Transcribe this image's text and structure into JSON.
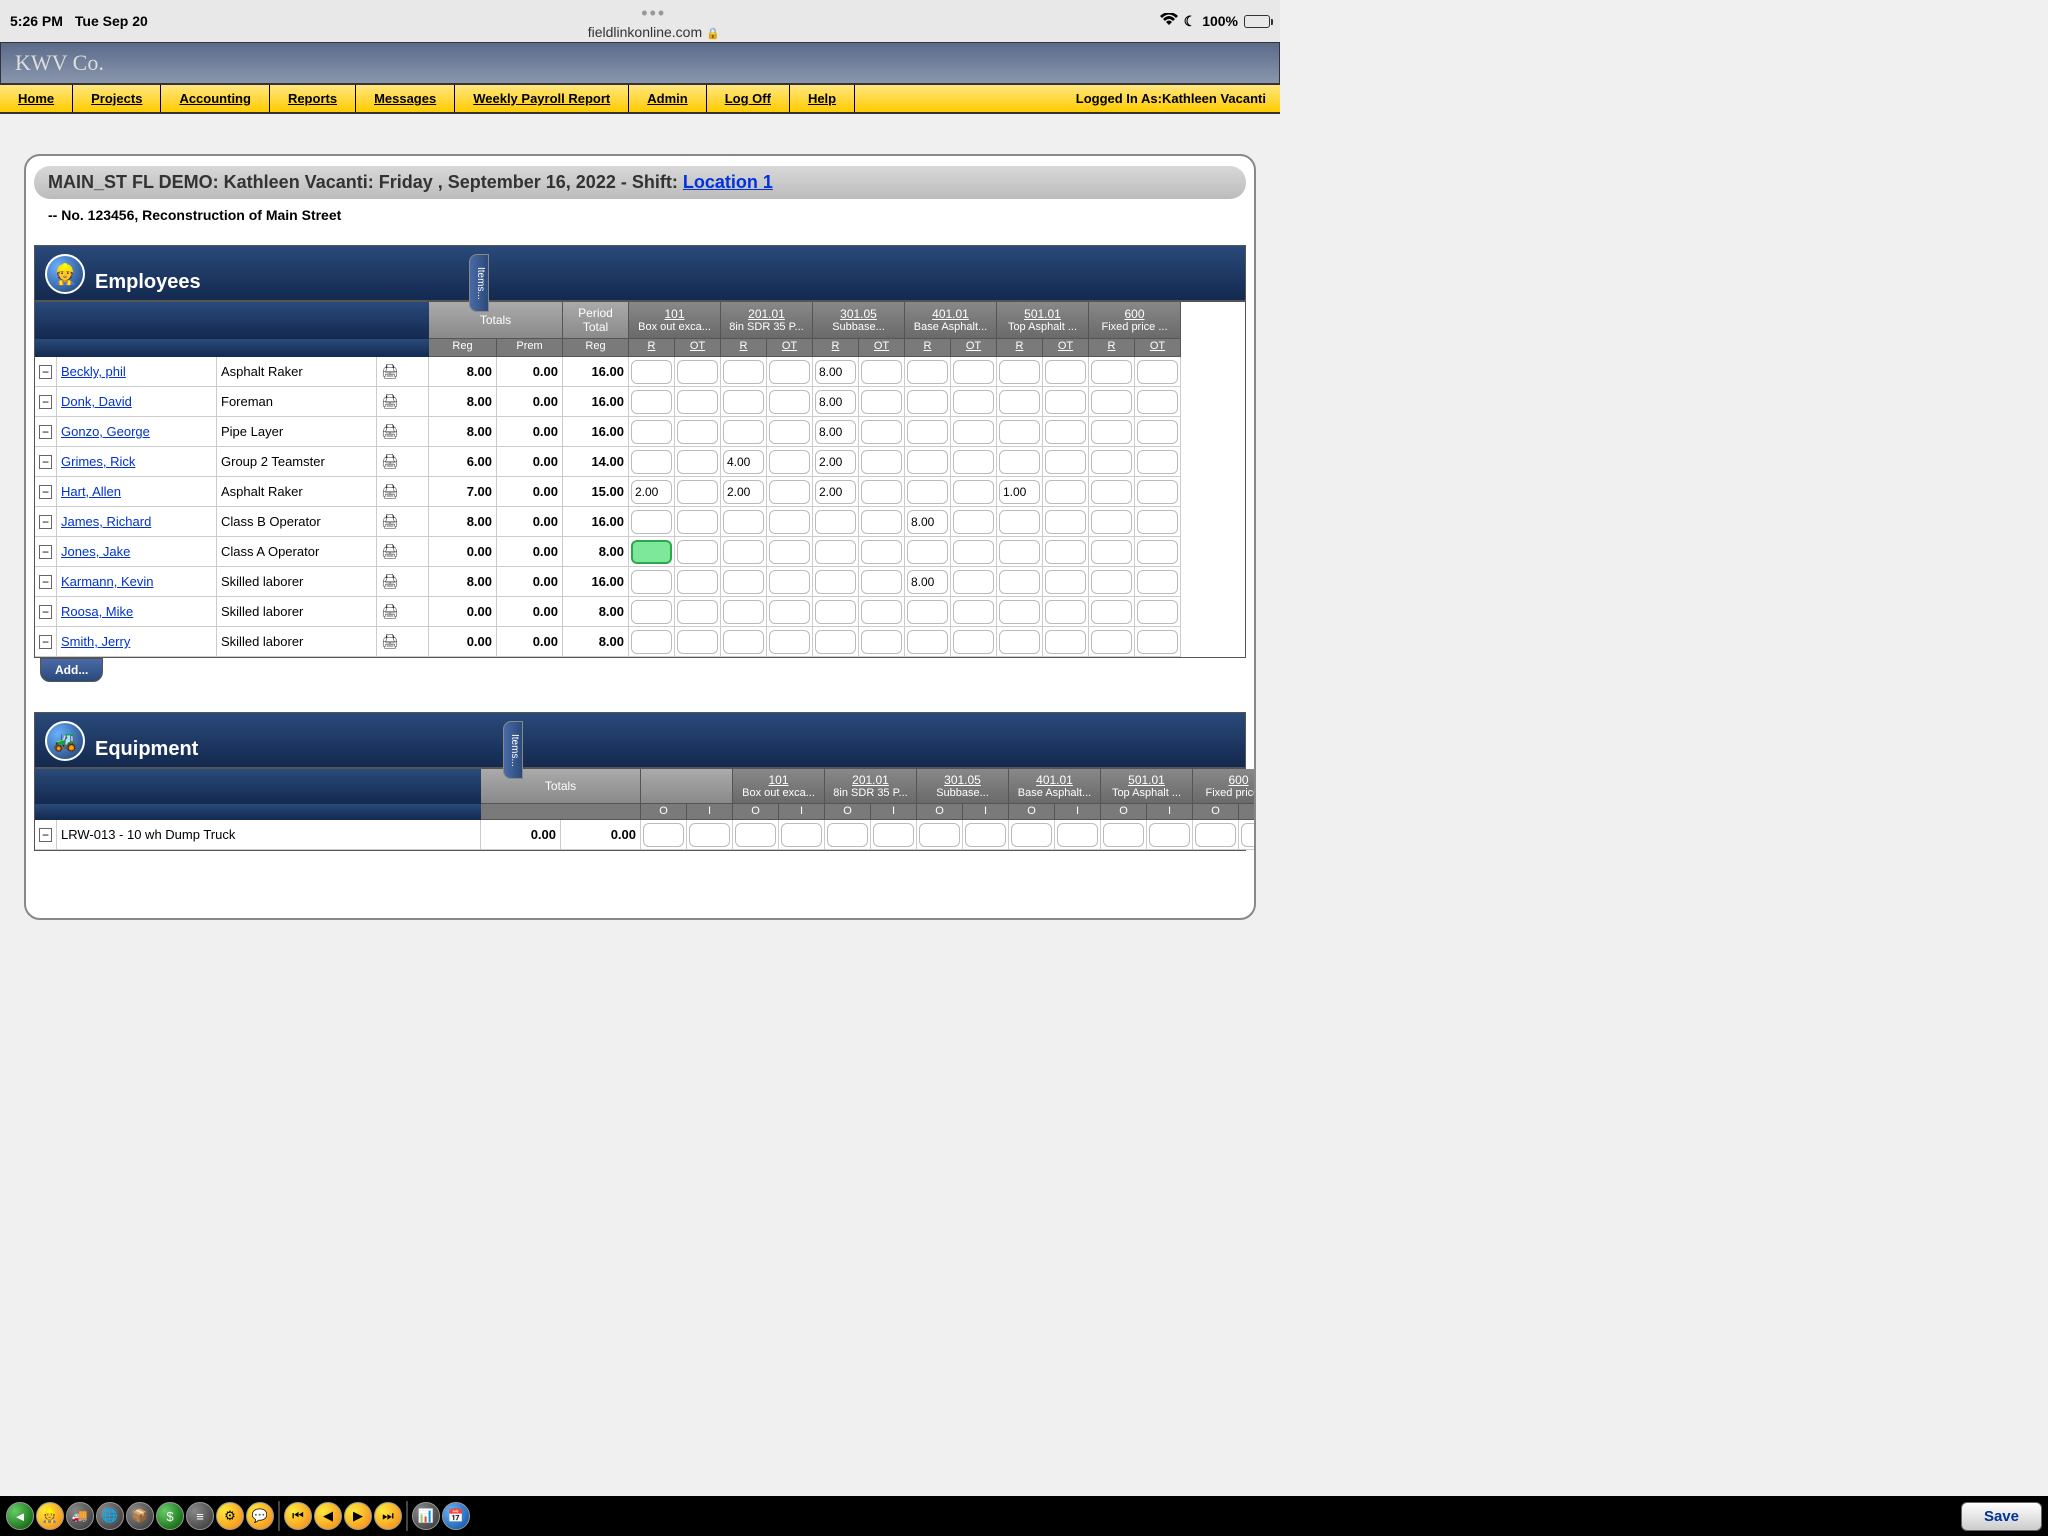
{
  "status": {
    "time": "5:26 PM",
    "date": "Tue Sep 20",
    "url": "fieldlinkonline.com",
    "battery": "100%"
  },
  "company": "KWV Co.",
  "nav": [
    "Home",
    "Projects",
    "Accounting",
    "Reports",
    "Messages",
    "Weekly Payroll Report",
    "Admin",
    "Log Off",
    "Help"
  ],
  "logged_prefix": "Logged In As: ",
  "logged_user": "Kathleen Vacanti",
  "page": {
    "title_pre": "MAIN_ST FL DEMO: Kathleen Vacanti: Friday , September 16, 2022 - Shift: ",
    "title_link": "Location 1",
    "subtitle": "-- No. 123456, Reconstruction of Main Street"
  },
  "items_label": "Items...",
  "sections": {
    "employees": {
      "title": "Employees",
      "add_label": "Add...",
      "tot_cols": [
        "Totals",
        "Period Total"
      ],
      "tot_sub": [
        "Reg",
        "Prem",
        "Reg"
      ],
      "cost_cols": [
        {
          "code": "101",
          "desc": "Box out exca..."
        },
        {
          "code": "201.01",
          "desc": "8in SDR 35 P..."
        },
        {
          "code": "301.05",
          "desc": "Subbase..."
        },
        {
          "code": "401.01",
          "desc": "Base Asphalt..."
        },
        {
          "code": "501.01",
          "desc": "Top Asphalt ..."
        },
        {
          "code": "600",
          "desc": "Fixed price ..."
        }
      ],
      "cost_sub": [
        "R",
        "OT"
      ],
      "rows": [
        {
          "name": "Beckly, phil",
          "role": "Asphalt Raker",
          "reg": "8.00",
          "prem": "0.00",
          "ptot": "16.00",
          "vals": [
            "",
            "",
            "",
            "",
            "8.00",
            "",
            "",
            "",
            "",
            "",
            "",
            ""
          ]
        },
        {
          "name": "Donk, David",
          "role": "Foreman",
          "reg": "8.00",
          "prem": "0.00",
          "ptot": "16.00",
          "vals": [
            "",
            "",
            "",
            "",
            "8.00",
            "",
            "",
            "",
            "",
            "",
            "",
            ""
          ]
        },
        {
          "name": "Gonzo, George",
          "role": "Pipe Layer",
          "reg": "8.00",
          "prem": "0.00",
          "ptot": "16.00",
          "vals": [
            "",
            "",
            "",
            "",
            "8.00",
            "",
            "",
            "",
            "",
            "",
            "",
            ""
          ]
        },
        {
          "name": "Grimes, Rick",
          "role": "Group 2 Teamster",
          "reg": "6.00",
          "prem": "0.00",
          "ptot": "14.00",
          "vals": [
            "",
            "",
            "4.00",
            "",
            "2.00",
            "",
            "",
            "",
            "",
            "",
            "",
            ""
          ]
        },
        {
          "name": "Hart, Allen",
          "role": "Asphalt Raker",
          "reg": "7.00",
          "prem": "0.00",
          "ptot": "15.00",
          "vals": [
            "2.00",
            "",
            "2.00",
            "",
            "2.00",
            "",
            "",
            "",
            "1.00",
            "",
            "",
            ""
          ]
        },
        {
          "name": "James, Richard",
          "role": "Class B Operator",
          "reg": "8.00",
          "prem": "0.00",
          "ptot": "16.00",
          "vals": [
            "",
            "",
            "",
            "",
            "",
            "",
            "8.00",
            "",
            "",
            "",
            "",
            ""
          ]
        },
        {
          "name": "Jones, Jake",
          "role": "Class A Operator",
          "reg": "0.00",
          "prem": "0.00",
          "ptot": "8.00",
          "vals": [
            "",
            "",
            "",
            "",
            "",
            "",
            "",
            "",
            "",
            "",
            "",
            ""
          ],
          "active_col": 0
        },
        {
          "name": "Karmann, Kevin",
          "role": "Skilled laborer",
          "reg": "8.00",
          "prem": "0.00",
          "ptot": "16.00",
          "vals": [
            "",
            "",
            "",
            "",
            "",
            "",
            "8.00",
            "",
            "",
            "",
            "",
            ""
          ]
        },
        {
          "name": "Roosa, Mike",
          "role": "Skilled laborer",
          "reg": "0.00",
          "prem": "0.00",
          "ptot": "8.00",
          "vals": [
            "",
            "",
            "",
            "",
            "",
            "",
            "",
            "",
            "",
            "",
            "",
            ""
          ]
        },
        {
          "name": "Smith, Jerry",
          "role": "Skilled laborer",
          "reg": "0.00",
          "prem": "0.00",
          "ptot": "8.00",
          "vals": [
            "",
            "",
            "",
            "",
            "",
            "",
            "",
            "",
            "",
            "",
            "",
            ""
          ]
        }
      ]
    },
    "equipment": {
      "title": "Equipment",
      "tot_label": "Totals",
      "cost_sub": [
        "O",
        "I"
      ],
      "rows": [
        {
          "name": "LRW-013 - 10 wh Dump Truck",
          "o": "0.00",
          "i": "0.00"
        }
      ]
    }
  },
  "save_label": "Save"
}
